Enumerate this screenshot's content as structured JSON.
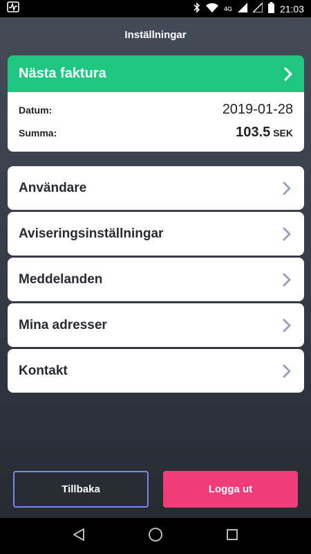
{
  "status_bar": {
    "time": "21:03",
    "network": "4G",
    "icons": [
      "activity-icon",
      "bluetooth-icon",
      "wifi-icon",
      "signal-icon",
      "signal-icon",
      "battery-icon"
    ]
  },
  "page": {
    "title": "Inställningar"
  },
  "invoice": {
    "header": "Nästa faktura",
    "date_label": "Datum:",
    "date_value": "2019-01-28",
    "amount_label": "Summa:",
    "amount_value": "103.5",
    "currency": "SEK"
  },
  "menu": {
    "items": [
      {
        "label": "Användare"
      },
      {
        "label": "Aviseringsinställningar"
      },
      {
        "label": "Meddelanden"
      },
      {
        "label": "Mina adresser"
      },
      {
        "label": "Kontakt"
      }
    ]
  },
  "buttons": {
    "back": "Tillbaka",
    "logout": "Logga ut"
  },
  "colors": {
    "accent_green": "#1ec77f",
    "logout_pink": "#f03c78",
    "back_border": "#7a86e8",
    "chevron": "#9ba0ba"
  }
}
